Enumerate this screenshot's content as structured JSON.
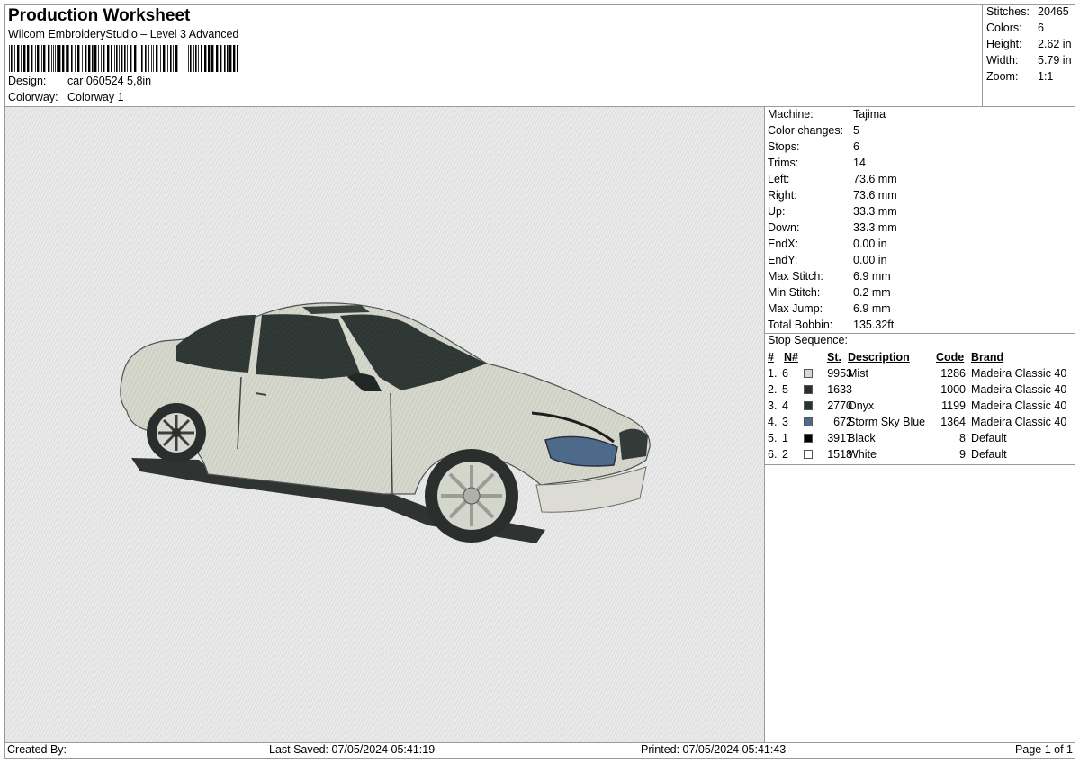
{
  "header": {
    "title": "Production Worksheet",
    "subtitle": "Wilcom EmbroideryStudio – Level 3 Advanced",
    "design_label": "Design:",
    "design_value": "car 060524 5,8in",
    "colorway_label": "Colorway:",
    "colorway_value": "Colorway 1"
  },
  "stats": [
    {
      "label": "Stitches:",
      "value": "20465"
    },
    {
      "label": "Colors:",
      "value": "6"
    },
    {
      "label": "Height:",
      "value": "2.62 in"
    },
    {
      "label": "Width:",
      "value": "5.79 in"
    },
    {
      "label": "Zoom:",
      "value": "1:1"
    }
  ],
  "machine_details": [
    {
      "label": "Machine:",
      "value": "Tajima"
    },
    {
      "label": "Color changes:",
      "value": "5"
    },
    {
      "label": "Stops:",
      "value": "6"
    },
    {
      "label": "Trims:",
      "value": "14"
    },
    {
      "label": "Left:",
      "value": "73.6 mm"
    },
    {
      "label": "Right:",
      "value": "73.6 mm"
    },
    {
      "label": "Up:",
      "value": "33.3 mm"
    },
    {
      "label": "Down:",
      "value": "33.3 mm"
    },
    {
      "label": "EndX:",
      "value": "0.00 in"
    },
    {
      "label": "EndY:",
      "value": "0.00 in"
    },
    {
      "label": "Max Stitch:",
      "value": "6.9 mm"
    },
    {
      "label": "Min Stitch:",
      "value": "0.2 mm"
    },
    {
      "label": "Max Jump:",
      "value": "6.9 mm"
    },
    {
      "label": "Total Bobbin:",
      "value": "135.32ft"
    }
  ],
  "stop_sequence": {
    "title": "Stop Sequence:",
    "columns": {
      "num": "#",
      "n": "N#",
      "st": "St.",
      "description": "Description",
      "code": "Code",
      "brand": "Brand"
    },
    "rows": [
      {
        "num": "1.",
        "n": "6",
        "color": "#d8d8d6",
        "st": "9953",
        "description": "Mist",
        "code": "1286",
        "brand": "Madeira Classic 40"
      },
      {
        "num": "2.",
        "n": "5",
        "color": "#2b2e2d",
        "st": "1633",
        "description": "",
        "code": "1000",
        "brand": "Madeira Classic 40"
      },
      {
        "num": "3.",
        "n": "4",
        "color": "#273330",
        "st": "2770",
        "description": "Onyx",
        "code": "1199",
        "brand": "Madeira Classic 40"
      },
      {
        "num": "4.",
        "n": "3",
        "color": "#4e6a8a",
        "st": "672",
        "description": "Storm Sky Blue",
        "code": "1364",
        "brand": "Madeira Classic 40"
      },
      {
        "num": "5.",
        "n": "1",
        "color": "#000000",
        "st": "3917",
        "description": "Black",
        "code": "8",
        "brand": "Default"
      },
      {
        "num": "6.",
        "n": "2",
        "color": "#ffffff",
        "st": "1518",
        "description": "White",
        "code": "9",
        "brand": "Default"
      }
    ]
  },
  "footer": {
    "created_by": "Created By:",
    "last_saved": "Last Saved: 07/05/2024 05:41:19",
    "printed": "Printed: 07/05/2024 05:41:43",
    "page": "Page 1 of 1"
  }
}
